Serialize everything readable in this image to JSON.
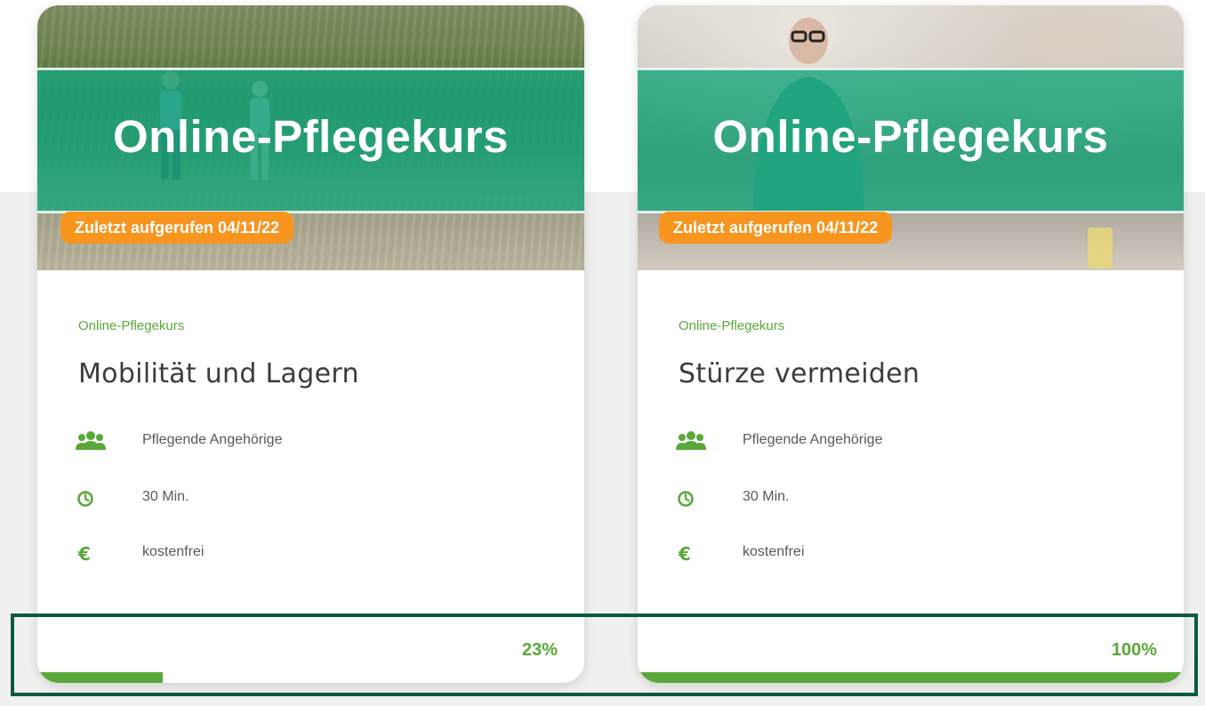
{
  "colors": {
    "accent_green": "#5aa83a",
    "badge_orange": "#f7951f",
    "teal_overlay": "#18a67d",
    "highlight_border": "#0b5a3d"
  },
  "cards": [
    {
      "banner_title": "Online-Pflegekurs",
      "last_viewed": "Zuletzt aufgerufen 04/11/22",
      "category": "Online-Pflegekurs",
      "title": "Mobilität und Lagern",
      "audience": "Pflegende Angehörige",
      "duration": "30 Min.",
      "price": "kostenfrei",
      "progress_label": "23%",
      "progress_fraction": 0.23,
      "icons": [
        "users-icon",
        "clock-icon",
        "euro-icon"
      ]
    },
    {
      "banner_title": "Online-Pflegekurs",
      "last_viewed": "Zuletzt aufgerufen 04/11/22",
      "category": "Online-Pflegekurs",
      "title": "Stürze vermeiden",
      "audience": "Pflegende Angehörige",
      "duration": "30 Min.",
      "price": "kostenfrei",
      "progress_label": "100%",
      "progress_fraction": 1.0,
      "icons": [
        "users-icon",
        "clock-icon",
        "euro-icon"
      ]
    }
  ]
}
